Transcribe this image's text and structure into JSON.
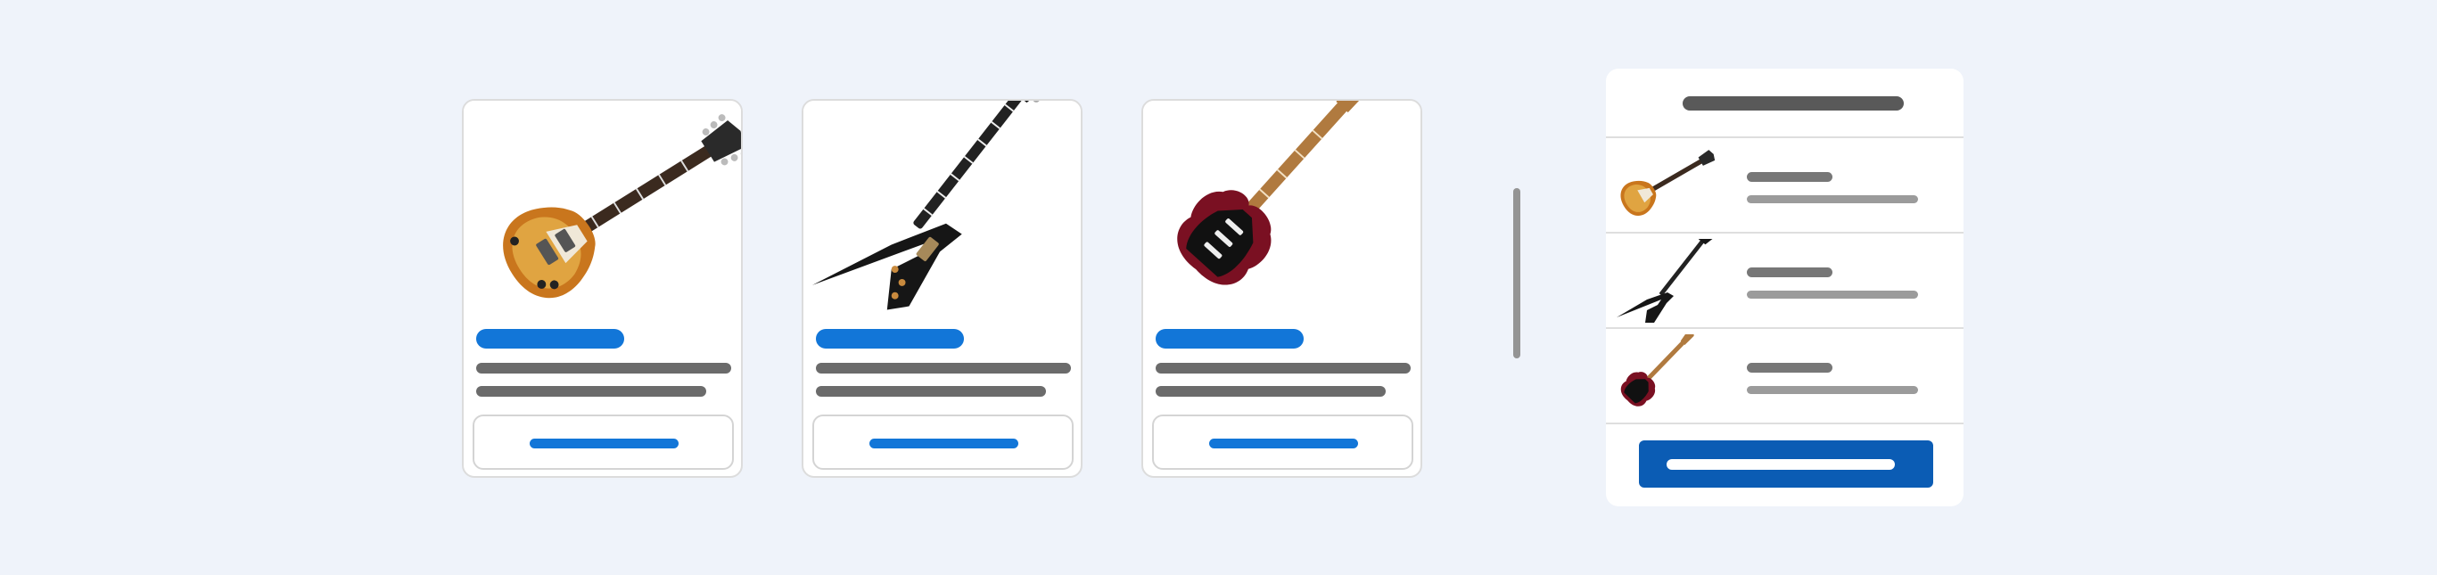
{
  "page": {
    "background": "#eff3fa"
  },
  "products": [
    {
      "id": "product-card-1",
      "image_icon": "sunburst-single-cut-guitar-icon",
      "body_color": "#c9761d",
      "headstock_color": "#2a2a2a"
    },
    {
      "id": "product-card-2",
      "image_icon": "black-v-shape-guitar-icon",
      "body_color": "#161616",
      "headstock_color": "#161616"
    },
    {
      "id": "product-card-3",
      "image_icon": "burgundy-strat-guitar-icon",
      "body_color": "#7a1022",
      "headstock_color": "#b07a3f"
    }
  ],
  "cart": {
    "items": [
      {
        "thumb_icon": "sunburst-single-cut-guitar-icon"
      },
      {
        "thumb_icon": "black-v-shape-guitar-icon"
      },
      {
        "thumb_icon": "burgundy-strat-guitar-icon"
      }
    ]
  },
  "colors": {
    "accent": "#1276d8",
    "checkout": "#0b5cb4",
    "skeleton_dark": "#6b6b6b",
    "skeleton_light": "#9b9b9b",
    "divider": "#949494"
  }
}
